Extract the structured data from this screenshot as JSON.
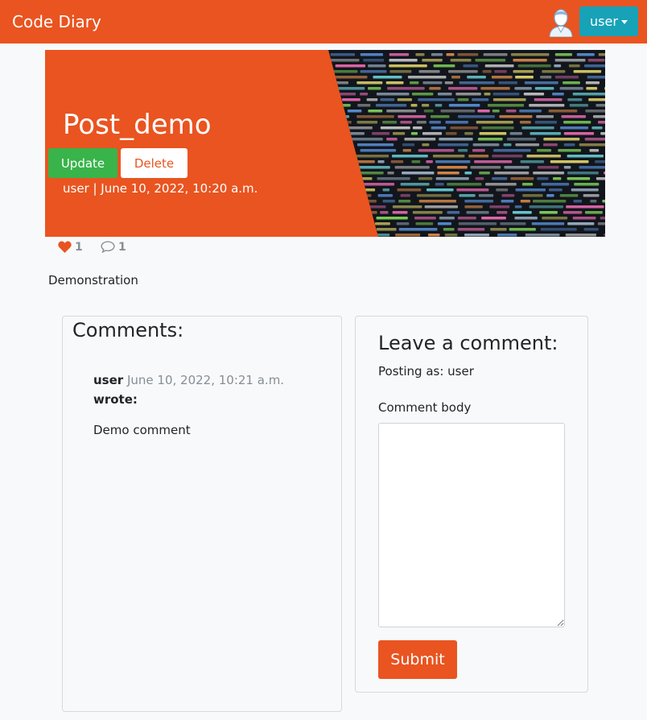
{
  "navbar": {
    "brand": "Code Diary",
    "user_label": "user"
  },
  "post": {
    "title": "Post_demo",
    "update_label": "Update",
    "delete_label": "Delete",
    "meta": "user | June 10, 2022, 10:20 a.m.",
    "likes": "1",
    "comments_count": "1",
    "body": "Demonstration"
  },
  "comments": {
    "title": "Comments:",
    "items": [
      {
        "author": "user",
        "date": "June 10, 2022, 10:21 a.m.",
        "verb": "wrote:",
        "body": "Demo comment"
      }
    ]
  },
  "form": {
    "title": "Leave a comment:",
    "posting_as": "Posting as: user",
    "field_label": "Comment body",
    "field_value": "",
    "submit_label": "Submit"
  },
  "icons": {
    "like": "heart-icon",
    "comment": "comment-icon",
    "avatar": "user-avatar-icon",
    "dropdown": "caret-down-icon"
  },
  "colors": {
    "primary": "#e95420",
    "success": "#38b44a",
    "info": "#17a2b8",
    "background": "#f8f9fa",
    "muted": "#868e96",
    "heart": "#e95420"
  }
}
